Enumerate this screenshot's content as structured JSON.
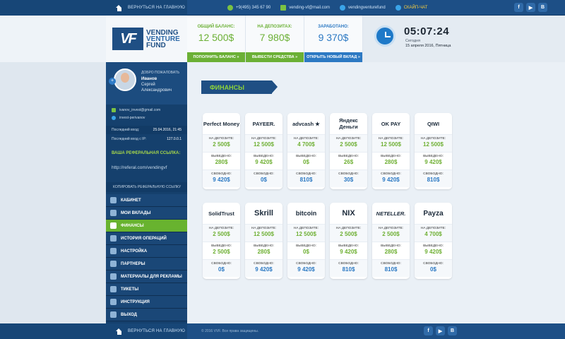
{
  "topbar": {
    "back_home": "Вернуться на главную",
    "phone": "+9(495) 345 67 90",
    "email": "vending-vf@mail.com",
    "skype": "vendingventurefund",
    "chat": "Скайп-чат",
    "social": [
      "f",
      "▶",
      "B"
    ]
  },
  "brand": {
    "mark": "VF",
    "line1": "VENDING",
    "line2": "VENTURE",
    "line3": "FUND"
  },
  "stats": [
    {
      "label": "Общий баланс:",
      "value": "12 500$",
      "button": "Пополнить баланс »",
      "color": "#6bb035"
    },
    {
      "label": "На депозитах:",
      "value": "7 980$",
      "button": "Вывести средства »",
      "color": "#6bb035"
    },
    {
      "label": "Заработано:",
      "value": "9 370$",
      "button": "Открыть новый вклад »",
      "color": "#2c79c3"
    }
  ],
  "clock": {
    "time": "05:07:24",
    "day": "Сегодня",
    "date": "15 апреля 2016, Пятница"
  },
  "profile": {
    "welcome": "Добро пожаловать",
    "surname": "Иванов",
    "firstname": "Сергей",
    "patronymic": "Александрович",
    "email": "ivanov_invest@gmail.com",
    "skype": "invest-perivanov",
    "last_login_label": "Последний вход:",
    "last_login": "25.04.2016, 21:45",
    "last_ip_label": "Последний вход с IP:",
    "last_ip": "127.0.0.1"
  },
  "referral": {
    "title": "Ваша реферальная ссылка:",
    "url": "http://referal.com/vendingvf",
    "copy": "Копировать реферальную ссылку"
  },
  "menu": [
    "Кабинет",
    "Мои вклады",
    "Финансы",
    "История операций",
    "Настройка",
    "Партнеры",
    "Материалы для рекламы",
    "Тикеты",
    "Инструкция",
    "Выход"
  ],
  "section_title": "ФИНАНСЫ",
  "labels": {
    "deposit": "На депозите:",
    "withdrawn": "Выведено:",
    "free": "Свободно:"
  },
  "cards_row1": [
    {
      "name": "Perfect Money",
      "deposit": "2 500$",
      "withdrawn": "280$",
      "free": "9 420$"
    },
    {
      "name": "PAYEER.",
      "deposit": "12 500$",
      "withdrawn": "9 420$",
      "free": "0$"
    },
    {
      "name": "advcash ★",
      "deposit": "4 700$",
      "withdrawn": "0$",
      "free": "810$"
    },
    {
      "name": "Яндекс Деньги",
      "deposit": "2 500$",
      "withdrawn": "26$",
      "free": "30$"
    },
    {
      "name": "OK PAY",
      "deposit": "12 500$",
      "withdrawn": "280$",
      "free": "9 420$"
    },
    {
      "name": "QIWI",
      "deposit": "12 500$",
      "withdrawn": "9 420$",
      "free": "810$"
    }
  ],
  "cards_row2": [
    {
      "name": "SolidTrust",
      "deposit": "2 500$",
      "withdrawn": "2 500$",
      "free": "0$"
    },
    {
      "name": "Skrill",
      "deposit": "12 500$",
      "withdrawn": "280$",
      "free": "9 420$"
    },
    {
      "name": "bitcoin",
      "deposit": "12 500$",
      "withdrawn": "0$",
      "free": "9 420$"
    },
    {
      "name": "NIX",
      "deposit": "2 500$",
      "withdrawn": "9 420$",
      "free": "810$"
    },
    {
      "name": "NETELLER.",
      "deposit": "2 500$",
      "withdrawn": "280$",
      "free": "810$"
    },
    {
      "name": "Payza",
      "deposit": "4 700$",
      "withdrawn": "9 420$",
      "free": "0$"
    }
  ],
  "footer": {
    "back_home": "Вернуться на главную",
    "copyright": "© 2016 VVF. Все права защищены."
  }
}
